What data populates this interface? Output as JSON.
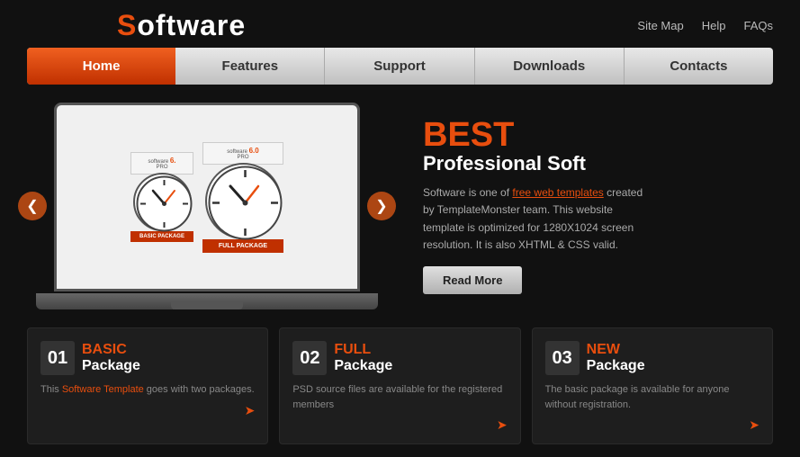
{
  "header": {
    "logo_prefix": "S",
    "logo_text": "oftware",
    "links": [
      {
        "label": "Site Map"
      },
      {
        "label": "Help"
      },
      {
        "label": "FAQs"
      }
    ]
  },
  "nav": {
    "items": [
      {
        "label": "Home",
        "active": true
      },
      {
        "label": "Features",
        "active": false
      },
      {
        "label": "Support",
        "active": false
      },
      {
        "label": "Downloads",
        "active": false
      },
      {
        "label": "Contacts",
        "active": false
      }
    ]
  },
  "hero": {
    "best": "BEST",
    "subtitle": "Professional Soft",
    "description": "Software is one of free web templates created by TemplateMonster team. This website template is optimized for 1280X1024 screen resolution. It is also XHTML & CSS valid.",
    "highlight1": "free web templates",
    "read_more": "Read More"
  },
  "cards": [
    {
      "number": "01",
      "label_top": "BASIC",
      "label_bottom": "Package",
      "description": "This Software Template goes with two packages."
    },
    {
      "number": "02",
      "label_top": "FULL",
      "label_bottom": "Package",
      "description": "PSD source files are available for the registered members"
    },
    {
      "number": "03",
      "label_top": "NEW",
      "label_bottom": "Package",
      "description": "The basic package is available for anyone without registration."
    }
  ]
}
